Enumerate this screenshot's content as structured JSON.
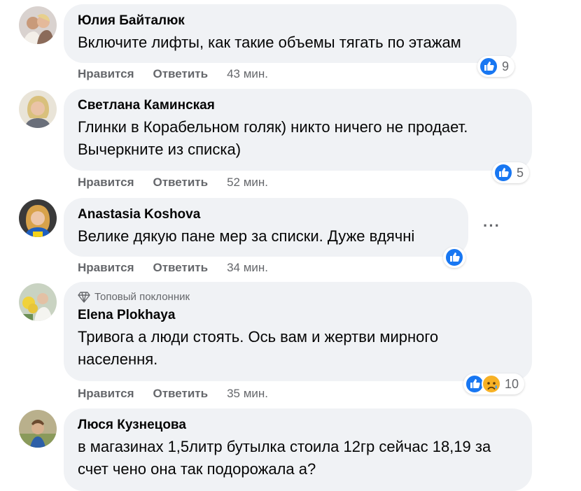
{
  "comments": [
    {
      "author": "Юлия Байталюк",
      "text": "Включите лифты, как такие объемы тягать по этажам",
      "like_label": "Нравится",
      "reply_label": "Ответить",
      "time": "43 мин.",
      "reaction_count": "9",
      "reactions": [
        "like-icon"
      ]
    },
    {
      "author": "Светлана Каминская",
      "text": "Глинки в Корабельном голяк) никто ничего не продает. Вычеркните из списка)",
      "like_label": "Нравится",
      "reply_label": "Ответить",
      "time": "52 мин.",
      "reaction_count": "5",
      "reactions": [
        "like-icon"
      ]
    },
    {
      "author": "Anastasia Koshova",
      "text": "Велике дякую пане мер за списки. Дуже вдячні",
      "like_label": "Нравится",
      "reply_label": "Ответить",
      "time": "34 мин.",
      "reaction_count": "",
      "reactions": [
        "like-icon"
      ],
      "more": "···"
    },
    {
      "badge": "Топовый поклонник",
      "author": "Elena Plokhaya",
      "text": "Тривога а люди стоять. Ось вам и жертви мирного населення.",
      "like_label": "Нравится",
      "reply_label": "Ответить",
      "time": "35 мин.",
      "reaction_count": "10",
      "reactions": [
        "like-icon",
        "sad-icon"
      ]
    },
    {
      "author": "Люся Кузнецова",
      "text": "в магазинах 1,5литр бутылка стоила 12гр сейчас 18,19 за счет чено она так подорожала а?"
    }
  ],
  "colors": {
    "bubble": "#f0f2f5",
    "meta": "#65676b",
    "like_blue": "#1877f2",
    "sad_yellow": "#f7b125"
  }
}
